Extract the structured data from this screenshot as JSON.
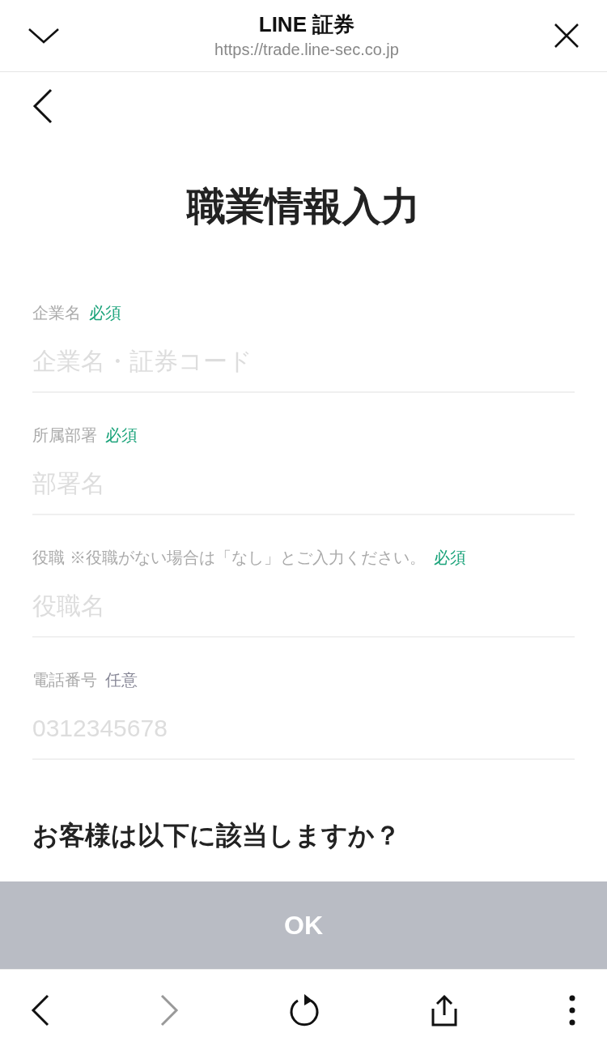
{
  "browser_bar": {
    "title": "LINE 証券",
    "url": "https://trade.line-sec.co.jp"
  },
  "page": {
    "title": "職業情報入力"
  },
  "fields": [
    {
      "label": "企業名",
      "tag": {
        "text": "必須",
        "kind": "required"
      },
      "placeholder": "企業名・証券コード"
    },
    {
      "label": "所属部署",
      "tag": {
        "text": "必須",
        "kind": "required"
      },
      "placeholder": "部署名"
    },
    {
      "label": "役職",
      "note": "※役職がない場合は「なし」とご入力ください。",
      "tag": {
        "text": "必須",
        "kind": "required"
      },
      "placeholder": "役職名"
    },
    {
      "label": "電話番号",
      "tag": {
        "text": "任意",
        "kind": "optional"
      },
      "placeholder": "0312345678"
    }
  ],
  "next_heading": "お客様は以下に該当しますか？",
  "ok_button": {
    "label": "OK",
    "disabled": true
  },
  "toolbar": {
    "back_disabled": false,
    "forward_disabled": true
  }
}
